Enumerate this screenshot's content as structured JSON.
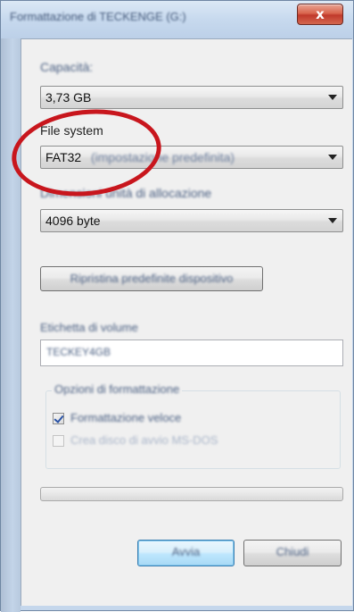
{
  "window": {
    "title": "Formattazione di TECKENGE (G:)",
    "close_label": "x"
  },
  "capacity": {
    "label": "Capacità:",
    "value": "3,73 GB"
  },
  "file_system": {
    "label": "File system",
    "value": "FAT32",
    "suffix": "(impostazione predefinita)"
  },
  "allocation": {
    "label": "Dimensioni unità di allocazione",
    "value": "4096 byte"
  },
  "restore_defaults_button": "Ripristina predefinite dispositivo",
  "volume_label": {
    "label": "Etichetta di volume",
    "value": "TECKEY4GB"
  },
  "format_options": {
    "legend": "Opzioni di formattazione",
    "quick_format": {
      "label": "Formattazione veloce",
      "checked": true
    },
    "msdos_disk": {
      "label": "Crea disco di avvio MS-DOS",
      "checked": false,
      "disabled": true
    }
  },
  "progress": 0,
  "buttons": {
    "start": "Avvia",
    "close": "Chiudi"
  },
  "colors": {
    "highlight_oval": "#c8161d",
    "close_button": "#c0392b",
    "default_button": "#3c7fb1"
  }
}
